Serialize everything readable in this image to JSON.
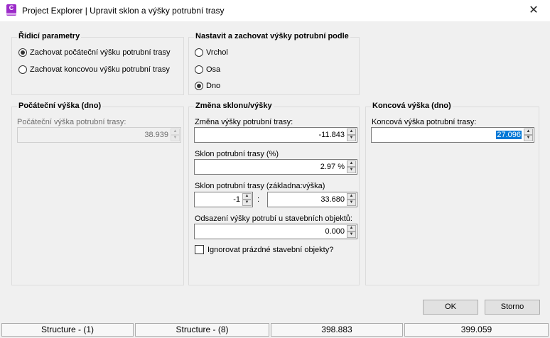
{
  "window": {
    "app_icon_letter": "C",
    "title": "Project Explorer | Upravit sklon a výšky potrubní trasy",
    "close_glyph": "✕"
  },
  "control_params": {
    "title": "Řídicí parametry",
    "options": [
      {
        "label": "Zachovat počáteční výšku potrubní trasy",
        "selected": true
      },
      {
        "label": "Zachovat koncovou výšku potrubní trasy",
        "selected": false
      }
    ]
  },
  "maintain_heights": {
    "title": "Nastavit a zachovat výšky potrubní podle",
    "options": [
      {
        "label": "Vrchol",
        "selected": false
      },
      {
        "label": "Osa",
        "selected": false
      },
      {
        "label": "Dno",
        "selected": true
      }
    ]
  },
  "start_height": {
    "title": "Počáteční výška (dno)",
    "field_label": "Počáteční výška potrubní trasy:",
    "value": "38.939",
    "enabled": false
  },
  "slope_change": {
    "title": "Změna sklonu/výšky",
    "height_change_label": "Změna výšky potrubní trasy:",
    "height_change_value": "-11.843",
    "slope_pct_label": "Sklon potrubní trasy (%)",
    "slope_pct_value": "2.97 %",
    "slope_ratio_label": "Sklon potrubní trasy (základna:výška)",
    "slope_ratio_base": "-1",
    "slope_ratio_separator": ":",
    "slope_ratio_height": "33.680",
    "offset_label": "Odsazení výšky potrubí u stavebních objektů:",
    "offset_value": "0.000",
    "ignore_label": "Ignorovat prázdné stavební objekty?",
    "ignore_checked": false
  },
  "end_height": {
    "title": "Koncová výška (dno)",
    "field_label": "Koncová výška potrubní trasy:",
    "value": "27.096"
  },
  "buttons": {
    "ok": "OK",
    "cancel": "Storno"
  },
  "statusbar": [
    "Structure - (1)",
    "Structure - (8)",
    "398.883",
    "399.059"
  ],
  "icons": {
    "spin_up": "▲",
    "spin_down": "▼"
  },
  "colors": {
    "accent": "#9c2bc9",
    "selection": "#0078d7"
  }
}
